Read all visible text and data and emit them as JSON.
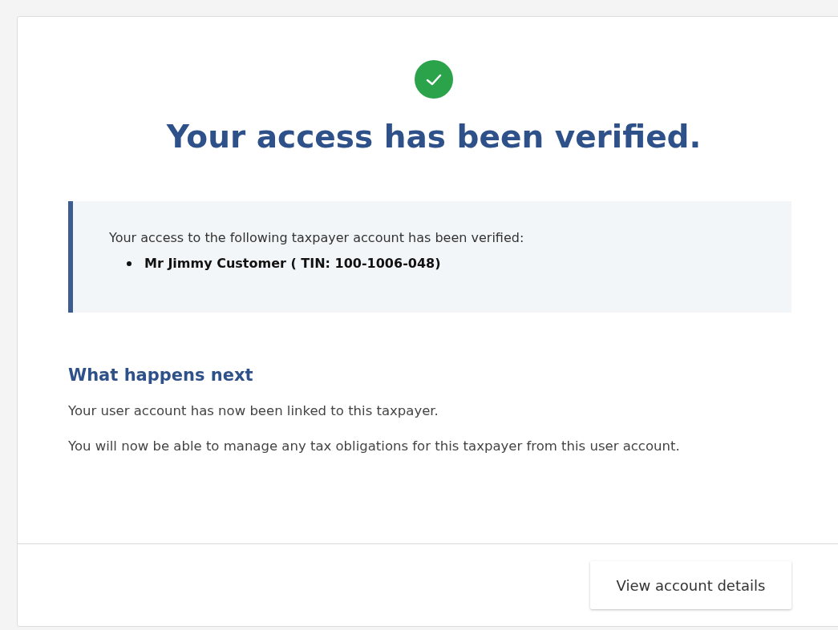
{
  "title": "Your access has been verified.",
  "callout": {
    "text": "Your access to the following taxpayer account has been verified:",
    "items": [
      "Mr Jimmy Customer ( TIN: 100-1006-048)"
    ]
  },
  "next": {
    "heading": "What happens next",
    "paragraphs": [
      "Your user account has now been linked to this taxpayer.",
      "You will now be able to manage any tax obligations for this taxpayer from this user account."
    ]
  },
  "button": "View account details"
}
